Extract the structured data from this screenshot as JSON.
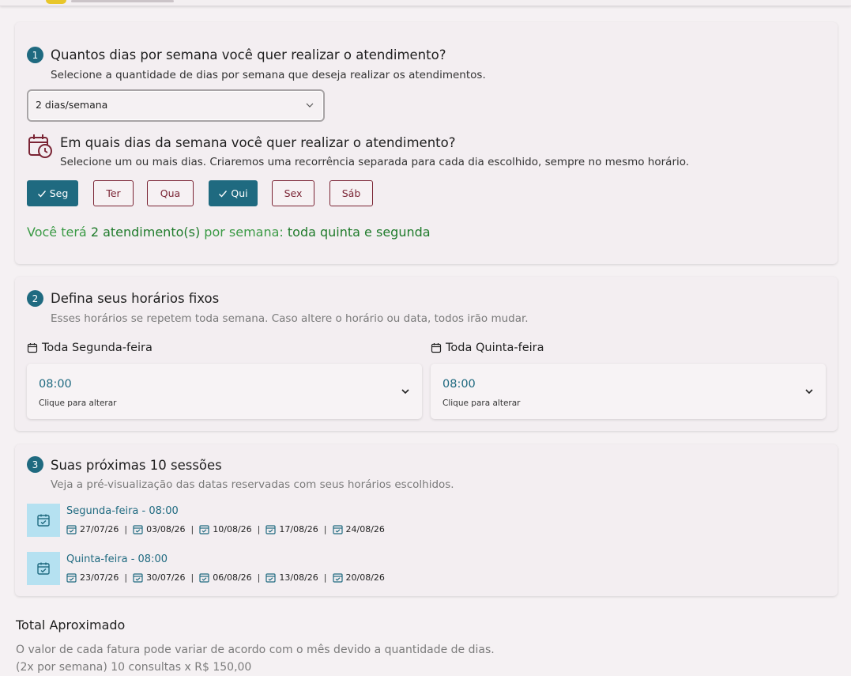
{
  "step1": {
    "number": "1",
    "title": "Quantos dias por semana você quer realizar o atendimento?",
    "subtitle": "Selecione a quantidade de dias por semana que deseja realizar os atendimentos.",
    "select_value": "2 dias/semana",
    "days_title": "Em quais dias da semana você quer realizar o atendimento?",
    "days_subtitle": "Selecione um ou mais dias. Criaremos uma recorrência separada para cada dia escolhido, sempre no mesmo horário.",
    "days": [
      {
        "label": "Seg",
        "selected": true
      },
      {
        "label": "Ter",
        "selected": false
      },
      {
        "label": "Qua",
        "selected": false
      },
      {
        "label": "Qui",
        "selected": true
      },
      {
        "label": "Sex",
        "selected": false
      },
      {
        "label": "Sáb",
        "selected": false
      }
    ],
    "summary_prefix": "Você terá ",
    "summary_count": "2 atendimento(s)",
    "summary_mid": " por semana: ",
    "summary_days": "toda quinta e segunda"
  },
  "step2": {
    "number": "2",
    "title": "Defina seus horários fixos",
    "subtitle": "Esses horários se repetem toda semana. Caso altere o horário ou data, todos irão mudar.",
    "slots": [
      {
        "label": "Toda Segunda-feira",
        "time": "08:00",
        "hint": "Clique para alterar"
      },
      {
        "label": "Toda Quinta-feira",
        "time": "08:00",
        "hint": "Clique para alterar"
      }
    ]
  },
  "step3": {
    "number": "3",
    "title": "Suas próximas 10 sessões",
    "subtitle": "Veja a pré-visualização das datas reservadas com seus horários escolhidos.",
    "groups": [
      {
        "title": "Segunda-feira - 08:00",
        "dates": [
          "27/07/26",
          "03/08/26",
          "10/08/26",
          "17/08/26",
          "24/08/26"
        ]
      },
      {
        "title": "Quinta-feira - 08:00",
        "dates": [
          "23/07/26",
          "30/07/26",
          "06/08/26",
          "13/08/26",
          "20/08/26"
        ]
      }
    ]
  },
  "total": {
    "title": "Total Aproximado",
    "note": "O valor de cada fatura pode variar de acordo com o mês devido a quantidade de dias.",
    "calc": "(2x por semana) 10 consultas x R$ 150,00"
  },
  "colors": {
    "accent": "#1f6a80",
    "day_border": "#7a2434",
    "success": "#3a9a45",
    "session_icon_bg": "#b5e1f1"
  },
  "icons": {
    "select_chevron": "chevron-down-icon",
    "days_header": "calendar-clock-icon",
    "day_check": "check-icon",
    "slot_label": "calendar-icon",
    "session": "calendar-check-icon"
  }
}
